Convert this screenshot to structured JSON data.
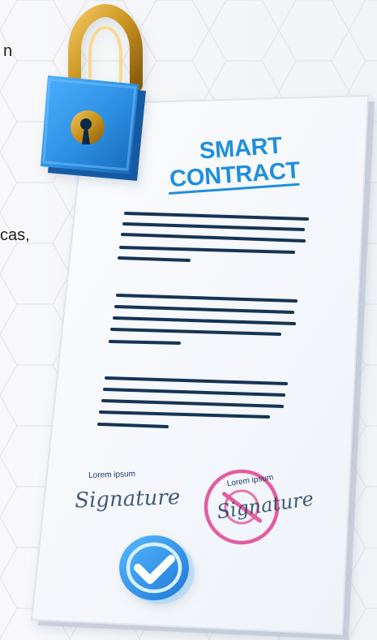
{
  "left_text": {
    "fragment_top": "n",
    "fragment_mid": "cas,"
  },
  "document": {
    "title_line_1": "SMART",
    "title_line_2": "CONTRACT",
    "signature_left_label": "Lorem ipsum",
    "signature_left_text": "Signature",
    "signature_right_label": "Lorem ipsum",
    "signature_right_text": "Signature"
  },
  "colors": {
    "background": "#f4f5f7",
    "hex_stroke": "#e1e4ea",
    "paper": "#f7f8fb",
    "paper_edge": "#dfe4ee",
    "title_blue": "#1f8fda",
    "line_navy": "#163454",
    "lock_blue": "#2d8fe2",
    "lock_gold": "#c7921d",
    "stamp_pink": "#e35da0",
    "check_blue": "#2b95e8"
  },
  "icons": {
    "lock": "padlock-icon",
    "check": "check-circle-icon",
    "stamp": "stamp-icon"
  }
}
